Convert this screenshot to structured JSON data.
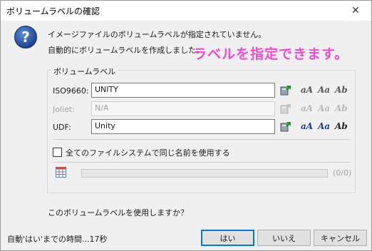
{
  "window": {
    "title": "ボリュームラベルの確認",
    "close_glyph": "✕"
  },
  "message": {
    "line1": "イメージファイルのボリュームラベルが指定されていません。",
    "line2": "自動的にボリュームラベルを作成しました。",
    "annotation": "ラベルを指定できます。",
    "annotation_color": "#f24bd0"
  },
  "group": {
    "label": "ボリュームラベル",
    "rows": [
      {
        "label": "ISO9660:",
        "value": "UNITY",
        "enabled": true
      },
      {
        "label": "Joliet:",
        "value": "N/A",
        "enabled": false
      },
      {
        "label": "UDF:",
        "value": "Unity",
        "enabled": true
      }
    ],
    "font_icon_glyphs": [
      "aA",
      "Aa",
      "Ab"
    ],
    "checkbox_label": "全てのファイルシステムで同じ名前を使用する",
    "checkbox_checked": false,
    "progress_fraction": 0,
    "progress_count": "(0/0)"
  },
  "question": "このボリュームラベルを使用しますか？",
  "status": "自動'はい'までの時間...17秒",
  "buttons": {
    "yes": "はい",
    "no": "いいえ",
    "cancel": "キャンセル"
  }
}
